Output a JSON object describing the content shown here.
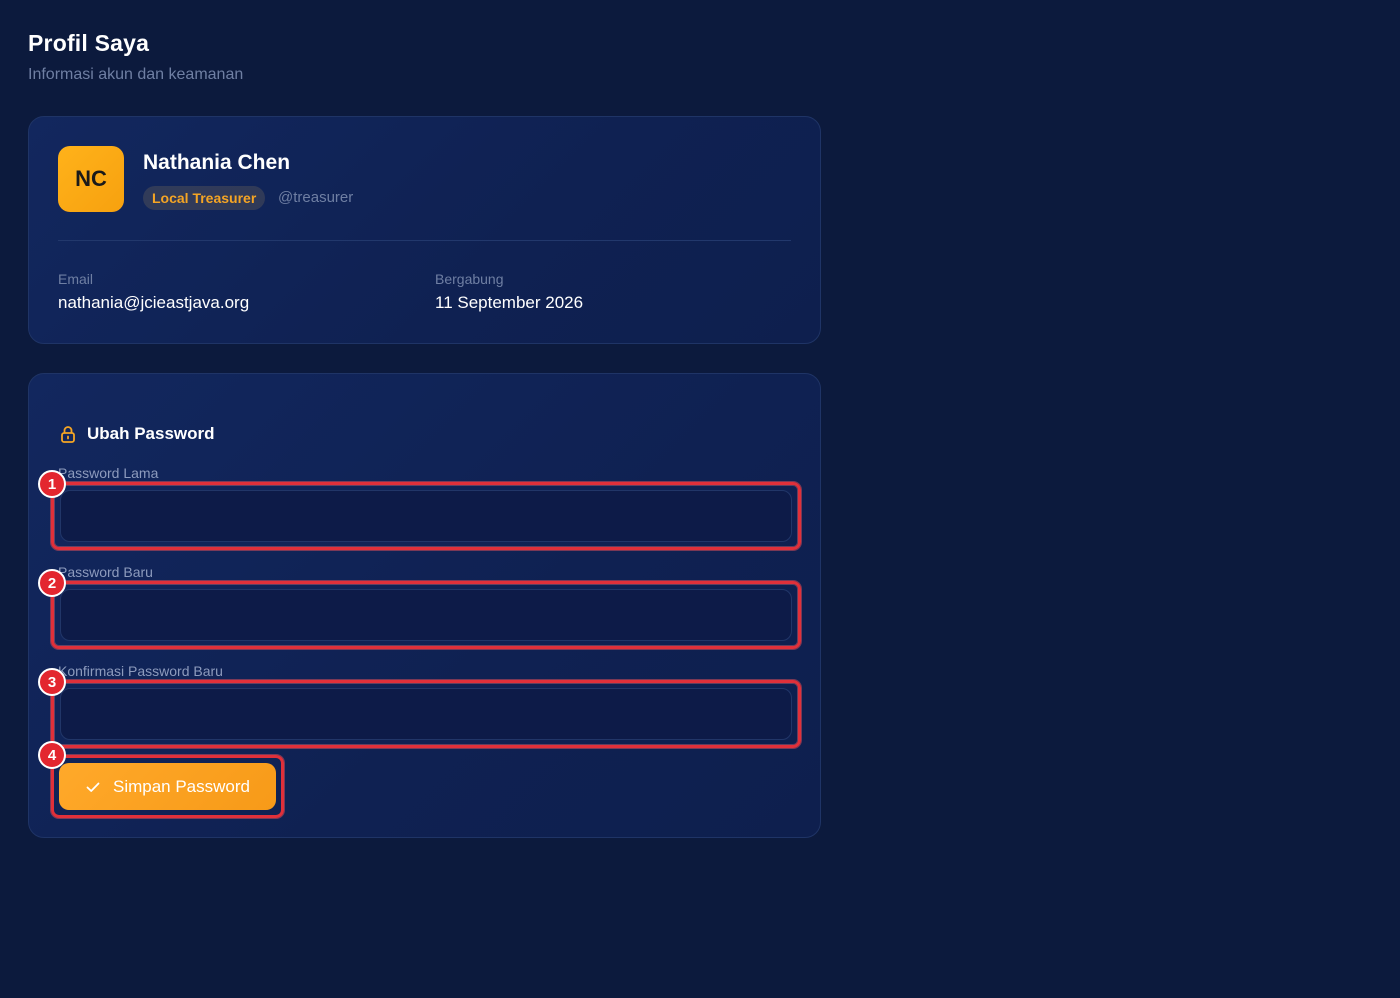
{
  "header": {
    "title": "Profil Saya",
    "subtitle": "Informasi akun dan keamanan"
  },
  "profile": {
    "initials": "NC",
    "name": "Nathania Chen",
    "role": "Local Treasurer",
    "username": "@treasurer",
    "email_label": "Email",
    "email_value": "nathania@jcieastjava.org",
    "joined_label": "Bergabung",
    "joined_value": "11 September 2026"
  },
  "password_form": {
    "title": "Ubah Password",
    "old_password_label": "Password Lama",
    "old_password_value": "",
    "new_password_label": "Password Baru",
    "new_password_value": "",
    "confirm_password_label": "Konfirmasi Password Baru",
    "confirm_password_value": "",
    "submit_label": "Simpan Password"
  },
  "markers": [
    "1",
    "2",
    "3",
    "4"
  ],
  "colors": {
    "background": "#0c1a3d",
    "card": "#12275e",
    "accent": "#f5a524",
    "highlight": "#e0303a"
  },
  "icons": {
    "section": "lock-icon",
    "submit": "check-icon"
  }
}
